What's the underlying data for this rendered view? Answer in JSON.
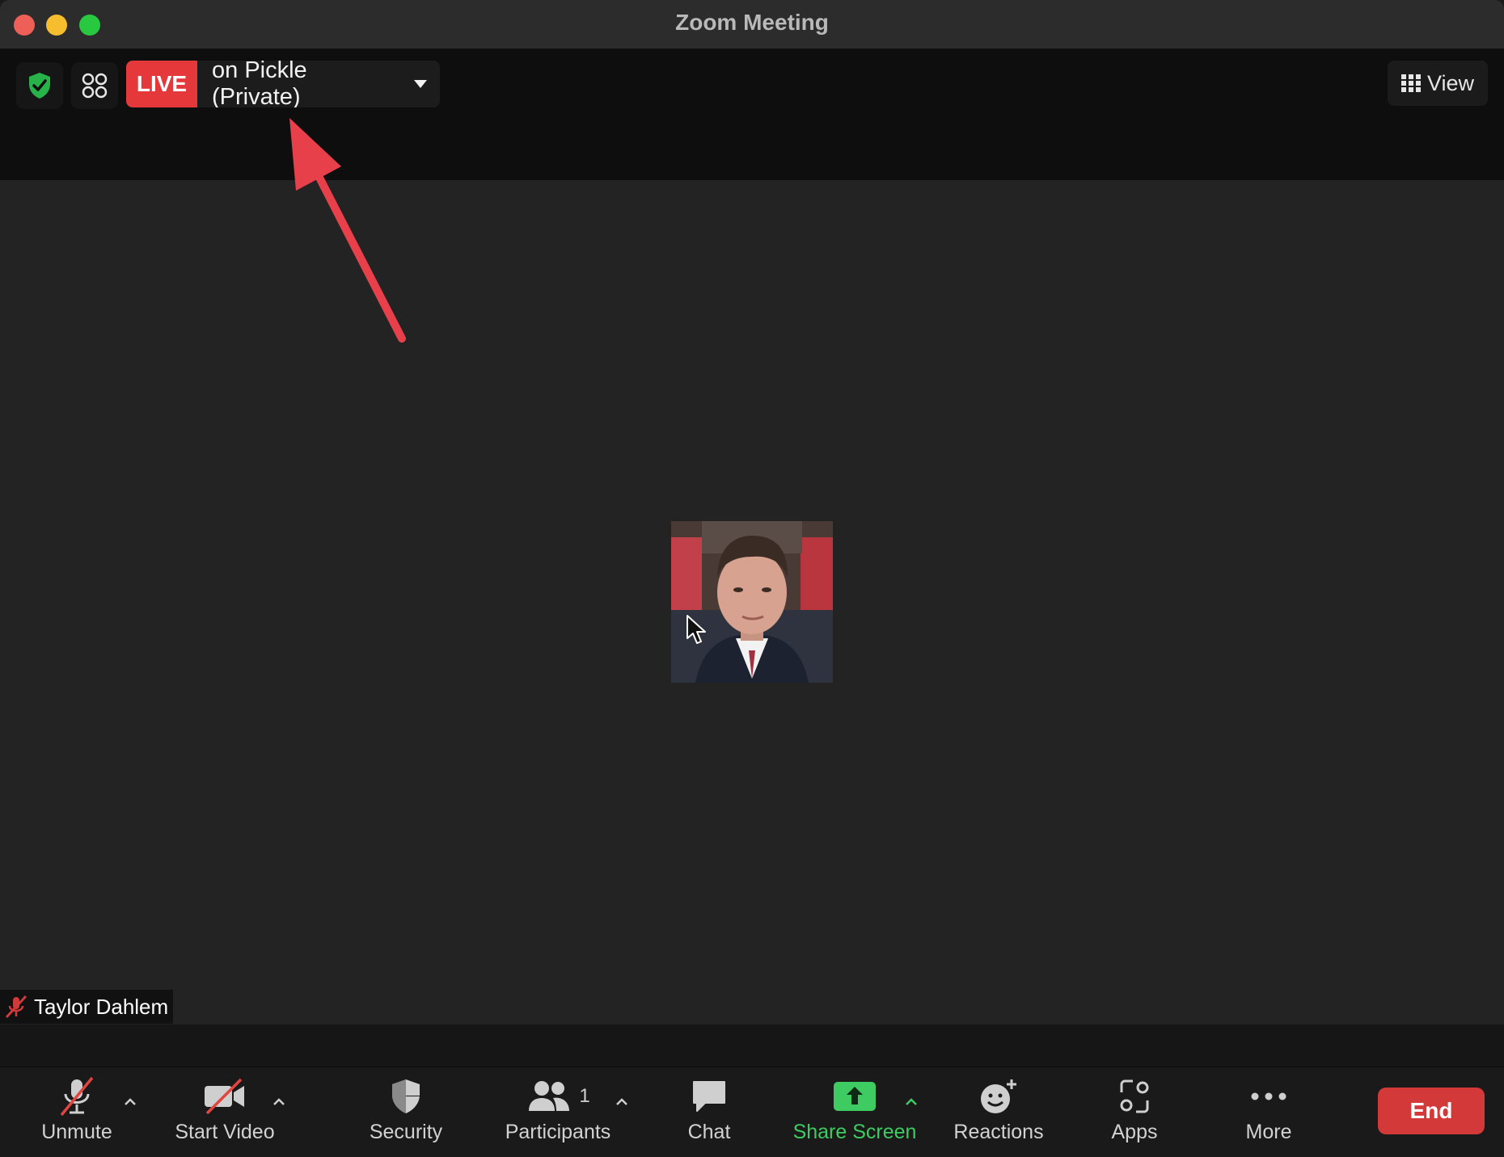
{
  "window": {
    "title": "Zoom Meeting"
  },
  "topbar": {
    "live_badge": "LIVE",
    "live_destination": "on Pickle (Private)",
    "view_label": "View"
  },
  "participant": {
    "name": "Taylor Dahlem"
  },
  "toolbar": {
    "unmute": "Unmute",
    "start_video": "Start Video",
    "security": "Security",
    "participants": "Participants",
    "participants_count": "1",
    "chat": "Chat",
    "share_screen": "Share Screen",
    "reactions": "Reactions",
    "apps": "Apps",
    "more": "More",
    "end": "End"
  },
  "colors": {
    "live_red": "#e5383b",
    "share_green": "#3ecb62",
    "end_red": "#d33939",
    "annotation_arrow": "#e8404a"
  },
  "icons": {
    "topbar": [
      "shield-check-icon",
      "apps-grid-icon",
      "chevron-down-icon",
      "grid-view-icon"
    ],
    "toolbar": [
      "microphone-muted-icon",
      "video-off-icon",
      "security-shield-icon",
      "participants-icon",
      "chat-bubble-icon",
      "share-screen-icon",
      "reactions-icon",
      "apps-icon",
      "more-dots-icon"
    ]
  }
}
